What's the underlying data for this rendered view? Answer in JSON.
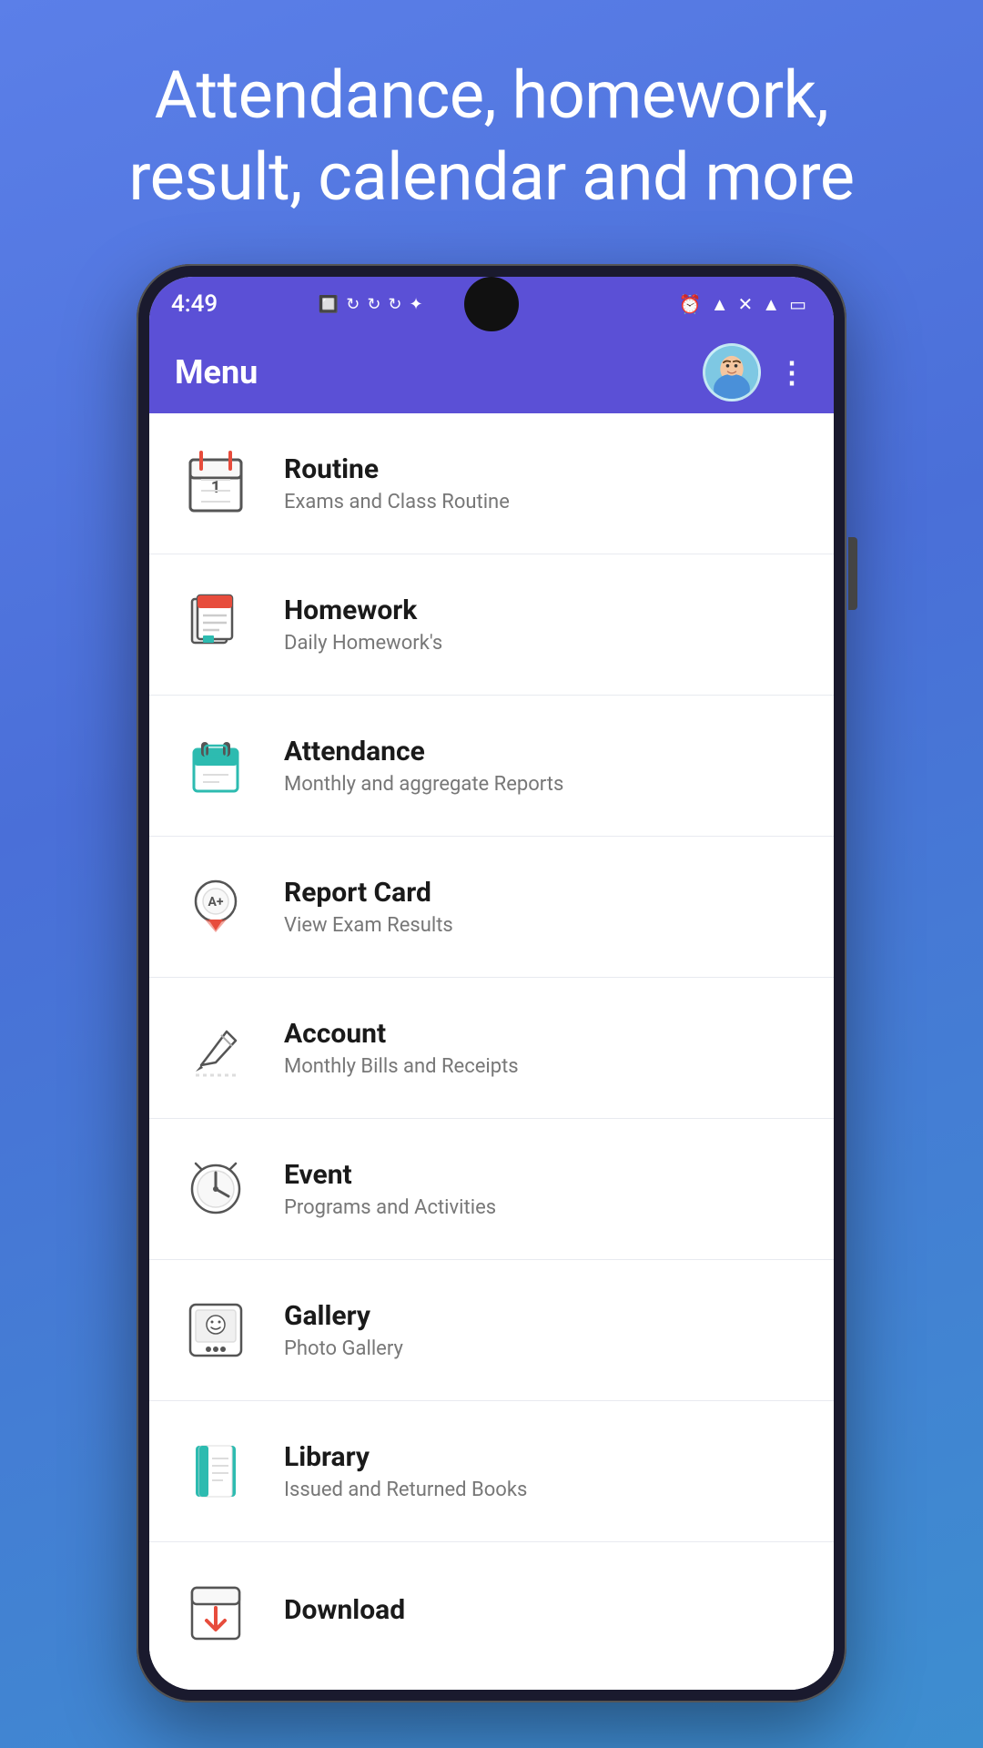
{
  "hero": {
    "text": "Attendance, homework, result, calendar and more"
  },
  "status_bar": {
    "time": "4:49",
    "left_icons": "⬛ ↻ ↻ ↻ ✦",
    "right_icons": "⏰ ▲ ✕ ▲ 🔋"
  },
  "app_bar": {
    "title": "Menu",
    "more_label": "⋮"
  },
  "menu_items": [
    {
      "id": "routine",
      "title": "Routine",
      "subtitle": "Exams and Class Routine",
      "icon": "routine"
    },
    {
      "id": "homework",
      "title": "Homework",
      "subtitle": "Daily Homework's",
      "icon": "homework"
    },
    {
      "id": "attendance",
      "title": "Attendance",
      "subtitle": "Monthly and aggregate Reports",
      "icon": "attendance"
    },
    {
      "id": "report-card",
      "title": "Report Card",
      "subtitle": "View Exam Results",
      "icon": "report-card"
    },
    {
      "id": "account",
      "title": "Account",
      "subtitle": "Monthly Bills and Receipts",
      "icon": "account"
    },
    {
      "id": "event",
      "title": "Event",
      "subtitle": "Programs and Activities",
      "icon": "event"
    },
    {
      "id": "gallery",
      "title": "Gallery",
      "subtitle": "Photo Gallery",
      "icon": "gallery"
    },
    {
      "id": "library",
      "title": "Library",
      "subtitle": "Issued and Returned Books",
      "icon": "library"
    },
    {
      "id": "download",
      "title": "Download",
      "subtitle": "",
      "icon": "download"
    }
  ],
  "colors": {
    "primary": "#5b50d6",
    "background": "#4a72d8",
    "icon_teal": "#2dbbb0",
    "icon_red": "#e74c3c",
    "icon_green": "#27ae60"
  }
}
